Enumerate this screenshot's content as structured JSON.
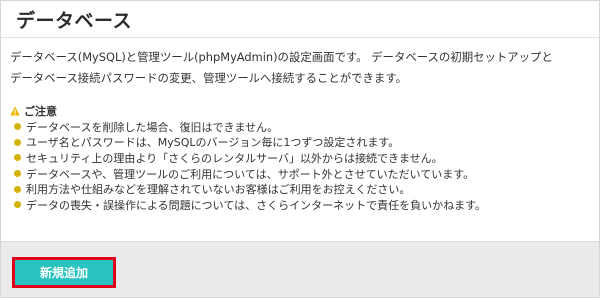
{
  "page": {
    "title": "データベース"
  },
  "description": {
    "lines": [
      "データベース(MySQL)と管理ツール(phpMyAdmin)の設定画面です。 データベースの初期セットアップと",
      "データベース接続パスワードの変更、管理ツールへ接続することができます。"
    ]
  },
  "notice": {
    "title": "ご注意",
    "icon": "warning-icon",
    "items": [
      "データベースを削除した場合、復旧はできません。",
      "ユーザ名とパスワードは、MySQLのバージョン毎に1つずつ設定されます。",
      "セキュリティ上の理由より「さくらのレンタルサーバ」以外からは接続できません。",
      "データベースや、管理ツールのご利用については、サポート外とさせていただいています。",
      "利用方法や仕組みなどを理解されていないお客様はご利用をお控えください。",
      "データの喪失・誤操作による問題については、さくらインターネットで責任を負いかねます。"
    ]
  },
  "footer": {
    "add_button_label": "新規追加"
  },
  "colors": {
    "button_bg": "#29c4c1",
    "button_highlight_border": "#e0001a",
    "bullet": "#d4b300",
    "warning": "#f0b400",
    "footer_bg": "#ebebeb"
  }
}
